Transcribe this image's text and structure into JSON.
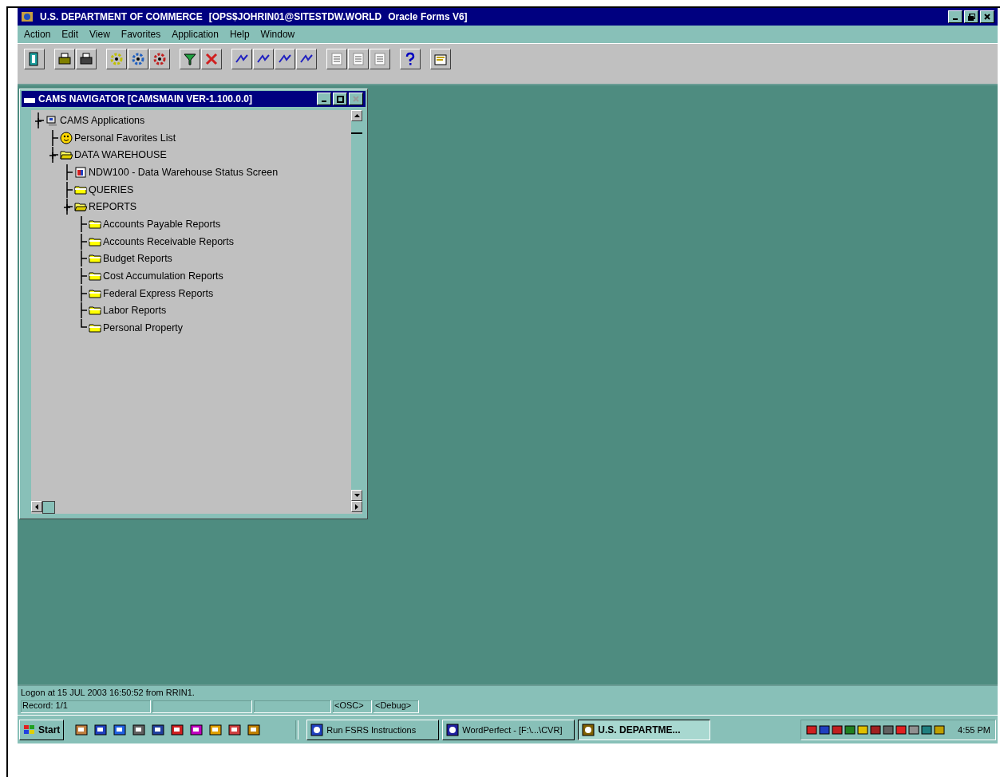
{
  "window": {
    "title": "U.S. DEPARTMENT OF COMMERCE",
    "session": "[OPS$JOHRIN01@SITESTDW.WORLD",
    "product": "Oracle Forms V6]"
  },
  "menu": [
    "Action",
    "Edit",
    "View",
    "Favorites",
    "Application",
    "Help",
    "Window"
  ],
  "navigator": {
    "title": "CAMS NAVIGATOR [CAMSMAIN VER-1.100.0.0]",
    "tree": [
      {
        "label": "CAMS Applications",
        "kind": "root",
        "children": [
          {
            "label": "Personal Favorites List",
            "kind": "favorites"
          },
          {
            "label": "DATA WAREHOUSE",
            "kind": "open-folder",
            "children": [
              {
                "label": "NDW100 - Data Warehouse Status Screen",
                "kind": "form"
              },
              {
                "label": "QUERIES",
                "kind": "folder"
              },
              {
                "label": "REPORTS",
                "kind": "open-folder",
                "children": [
                  {
                    "label": "Accounts Payable Reports",
                    "kind": "folder"
                  },
                  {
                    "label": "Accounts Receivable Reports",
                    "kind": "folder"
                  },
                  {
                    "label": "Budget Reports",
                    "kind": "folder"
                  },
                  {
                    "label": "Cost Accumulation Reports",
                    "kind": "folder"
                  },
                  {
                    "label": "Federal Express Reports",
                    "kind": "folder"
                  },
                  {
                    "label": "Labor Reports",
                    "kind": "folder"
                  },
                  {
                    "label": "Personal Property",
                    "kind": "folder"
                  }
                ]
              }
            ]
          }
        ]
      }
    ]
  },
  "status_bar": {
    "message": "Logon at 15 JUL 2003 16:50:52 from RRIN1.",
    "fields": [
      "Record: 1/1",
      "<OSC>",
      "<Debug>"
    ]
  },
  "taskbar": {
    "start": "Start",
    "tasks": [
      {
        "label": "Run FSRS Instructions",
        "selected": false
      },
      {
        "label": "WordPerfect - [F:\\...\\CVR]",
        "selected": false
      },
      {
        "label": "U.S. DEPARTME...",
        "selected": true
      }
    ],
    "clock": "4:55 PM"
  }
}
